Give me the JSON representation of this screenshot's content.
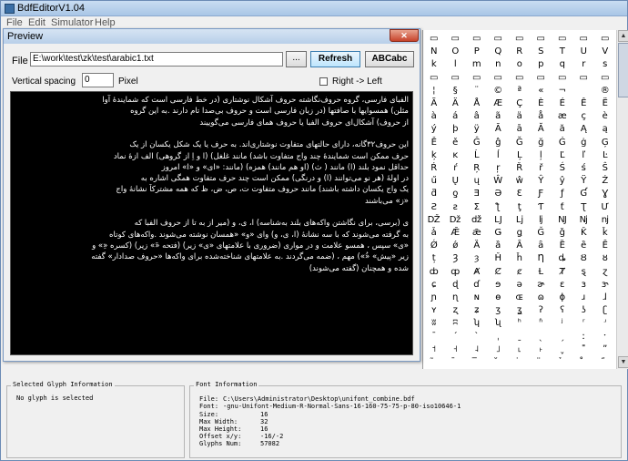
{
  "app": {
    "title": "BdfEditorV1.04"
  },
  "menu": [
    "File",
    "Edit",
    "Simulator",
    "Help"
  ],
  "preview": {
    "title": "Preview",
    "close_symbol": "✕",
    "file_label": "File",
    "file_value": "E:\\work\\test\\zk\\test\\arabic1.txt",
    "browse_label": "...",
    "refresh_label": "Refresh",
    "sample_label": "ABCabc",
    "vertical_spacing_label": "Vertical spacing",
    "vertical_spacing_value": "0",
    "pixel_label": "Pixel",
    "rtl_checked": false,
    "rtl_label": "Right -> Left",
    "lines": [
      "الفبای فارسی، گروه حروف‌نگاشته حروف آشکال نوشتاری (در خط فارسی است که شمایندهٔ آوا",
      "مثلن) همسوایها با صافتها (در زبان فارسی است و حروف بی‌صدا تام دارند .به این گروه",
      "از حروف) آشکال‌ای حروف الفبا یا حروف همای فارسی می‌گوییند",
      "",
      "این حروف۳۲گانه، دارای حالتهای متفاوت نوشتاری‌اند. به حرف یا یک شکل یکسان از یک",
      "حرف ممکن است شمایندهٔ چند واج متفاوت باشد) مانند غلغل) (ا و اِ از گروهی) الف ازهٔ نماد",
      "حداقل نمود بلند (ا) مانند ( ث) (او هم مانند) همزه) (مانند: «ای» و «ا» امروز",
      "در اولهٔ (هر نو می‌توانند (ا) و درنگی) ممکن است چند حرف متفاوت همگی اشاره به",
      "یک واج یکسان داشته باشند) مانند حروف متفاوت ت، ص، ض، ظ که همه مشترکاً نشانهٔ واج",
      "«ز» می‌باشند",
      "",
      "ی (برسی، برای نگاشتن واکه‌های بلند به‌شناسه) ا، ی، و (میر از به تا از حروف الفبا که",
      "به گرفته می‌شوند که با سه نشانهٔ (ا، ی، و) وای «و» «همسان نوشته می‌شوند .واکه‌های کوتاه",
      "«ی» سپس ، همسو علامت و در مواری (ضروری با علامتهای «ی» زیر) (فتحه «َ» زیر) (کسره «ِ» و",
      "زیر «پیش» «ُ») مهم ، (ضمه می‌گردند .به علامتهای شناخته‌شده برای واکه‌ها «حروف صدادار» گفته",
      "شده و همچنان (گفته می‌شوند)"
    ]
  },
  "glyph_table": {
    "rows": [
      [
        "▭",
        "▭",
        "▭",
        "▭",
        "▭",
        "▭",
        "▭",
        "▭",
        "▭"
      ],
      [
        "N",
        "O",
        "P",
        "Q",
        "R",
        "S",
        "T",
        "U",
        "V"
      ],
      [
        "k",
        "l",
        "m",
        "n",
        "o",
        "p",
        "q",
        "r",
        "s"
      ],
      [
        "▭",
        "▭",
        "▭",
        "▭",
        "▭",
        "▭",
        "▭",
        "▭",
        "▭"
      ],
      [
        "¦",
        "§",
        "¨",
        "©",
        "ª",
        "«",
        "¬",
        "­",
        "®"
      ],
      [
        "Ã",
        "Ä",
        "Å",
        "Æ",
        "Ç",
        "È",
        "É",
        "Ê",
        "Ë"
      ],
      [
        "à",
        "á",
        "â",
        "ã",
        "ä",
        "å",
        "æ",
        "ç",
        "è"
      ],
      [
        "ý",
        "þ",
        "ÿ",
        "Ā",
        "ā",
        "Ă",
        "ă",
        "Ą",
        "ą"
      ],
      [
        "Ě",
        "ě",
        "Ĝ",
        "ĝ",
        "Ğ",
        "ğ",
        "Ġ",
        "ġ",
        "Ģ"
      ],
      [
        "ķ",
        "ĸ",
        "Ĺ",
        "ĺ",
        "Ļ",
        "ļ",
        "Ľ",
        "ľ",
        "Ŀ"
      ],
      [
        "Ŕ",
        "ŕ",
        "Ŗ",
        "ŗ",
        "Ř",
        "ř",
        "Ś",
        "ś",
        "Ŝ"
      ],
      [
        "ű",
        "Ų",
        "ų",
        "Ŵ",
        "ŵ",
        "Ŷ",
        "ŷ",
        "Ÿ",
        "Ź"
      ],
      [
        "ƌ",
        "ƍ",
        "Ǝ",
        "Ə",
        "Ɛ",
        "Ƒ",
        "ƒ",
        "Ɠ",
        "Ɣ"
      ],
      [
        "Ƨ",
        "ƨ",
        "Ʃ",
        "ƪ",
        "ƫ",
        "Ƭ",
        "ƭ",
        "Ʈ",
        "Ư"
      ],
      [
        "Ǆ",
        "ǅ",
        "ǆ",
        "Ǉ",
        "ǈ",
        "ǉ",
        "Ǌ",
        "ǋ",
        "ǌ"
      ],
      [
        "ǡ",
        "Ǣ",
        "ǣ",
        "Ǥ",
        "ǥ",
        "Ǧ",
        "ǧ",
        "Ǩ",
        "ǩ"
      ],
      [
        "Ǿ",
        "ǿ",
        "Ȁ",
        "ȁ",
        "Ȃ",
        "ȃ",
        "Ȅ",
        "ȅ",
        "Ȇ"
      ],
      [
        "ț",
        "Ȝ",
        "ȝ",
        "Ȟ",
        "ȟ",
        "Ƞ",
        "ȡ",
        "Ȣ",
        "ȣ"
      ],
      [
        "ȸ",
        "ȹ",
        "Ⱥ",
        "Ȼ",
        "ȼ",
        "Ƚ",
        "Ⱦ",
        "ȿ",
        "ɀ"
      ],
      [
        "ɕ",
        "ɖ",
        "ɗ",
        "ɘ",
        "ə",
        "ɚ",
        "ɛ",
        "ɜ",
        "ɝ"
      ],
      [
        "ɲ",
        "ɳ",
        "ɴ",
        "ɵ",
        "ɶ",
        "ɷ",
        "ɸ",
        "ɹ",
        "ɺ"
      ],
      [
        "ʏ",
        "ʐ",
        "ʑ",
        "ʒ",
        "ʓ",
        "ʔ",
        "ʕ",
        "ʖ",
        "ʗ"
      ],
      [
        "ʬ",
        "ʭ",
        "ʮ",
        "ʯ",
        "ʰ",
        "ʱ",
        "ʲ",
        "ʳ",
        "ʴ"
      ],
      [
        "ˉ",
        "ˊ",
        "ˋ",
        "ˌ",
        "ˍ",
        "ˎ",
        "ˏ",
        "ː",
        "ˑ"
      ],
      [
        "˦",
        "˧",
        "˨",
        "˩",
        "˪",
        "˫",
        "ˬ",
        "˭",
        "ˮ"
      ],
      [
        "̃",
        "̄",
        "̅",
        "̆",
        "̇",
        "̈",
        "̉",
        "̊",
        "̋"
      ]
    ]
  },
  "selected_glyph": {
    "title": "Selected Glyph Information",
    "message": "No glyph is selected"
  },
  "font_info": {
    "title": "Font Information",
    "file_label": "File:",
    "file_value": "C:\\Users\\Administrator\\Desktop\\unifont_combine.bdf",
    "font_label": "Font:",
    "font_value": "-gnu-Unifont-Medium-R-Normal-Sans-16-160-75-75-p-80-iso10646-1",
    "fields": [
      {
        "key": "Size:",
        "value": "16"
      },
      {
        "key": "Max Width:",
        "value": "32"
      },
      {
        "key": "Max Height:",
        "value": "16"
      },
      {
        "key": "Offset x/y:",
        "value": "-16/-2"
      },
      {
        "key": "Glyphs Num:",
        "value": "57082"
      }
    ]
  }
}
